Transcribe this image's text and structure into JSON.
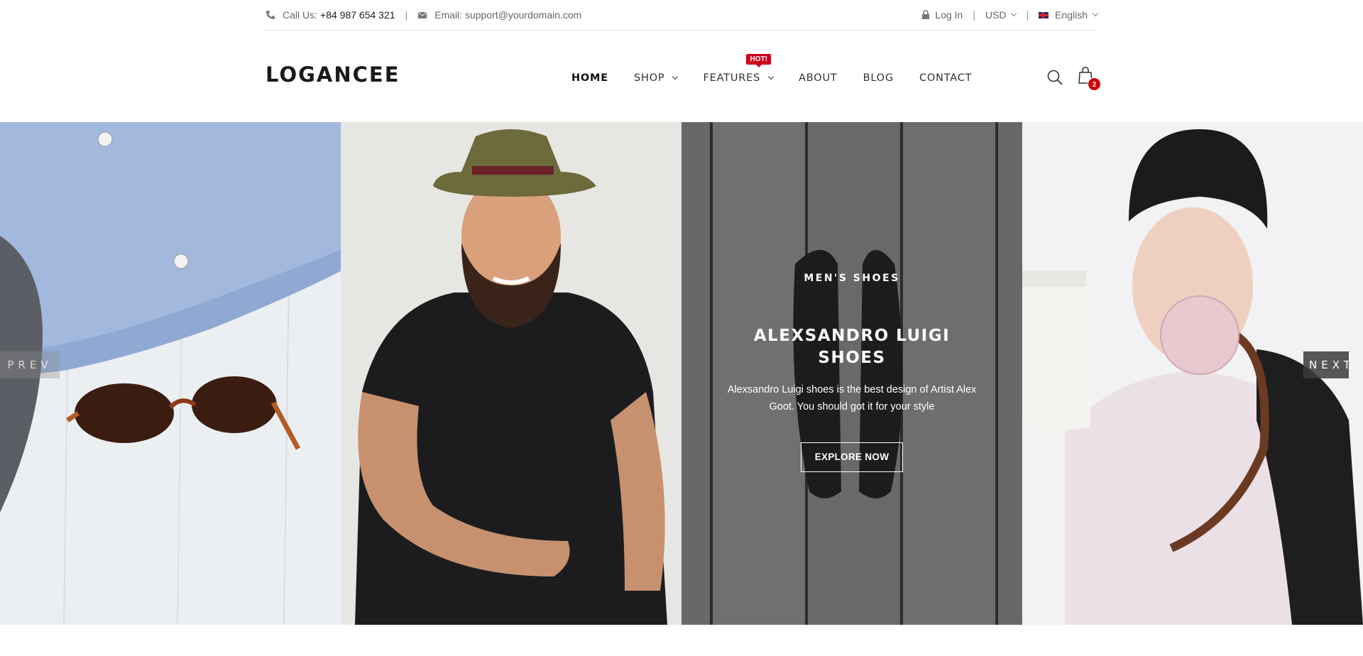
{
  "topbar": {
    "call_label": "Call Us:",
    "phone": "+84 987 654 321",
    "email": "Email: support@yourdomain.com",
    "login": "Log In",
    "currency": "USD",
    "language": "English"
  },
  "header": {
    "logo": "LOGANCEE",
    "nav": [
      {
        "label": "HOME",
        "active": true
      },
      {
        "label": "SHOP"
      },
      {
        "label": "FEATURES",
        "badge": "HOT!"
      },
      {
        "label": "ABOUT"
      },
      {
        "label": "BLOG"
      },
      {
        "label": "CONTACT"
      }
    ],
    "cart_count": "2"
  },
  "slider": {
    "prev": "PREV",
    "next": "NEXT",
    "caption": {
      "subtitle": "MEN'S SHOES",
      "title": "ALEXSANDRO LUIGI SHOES",
      "description": "Alexsandro Luigi shoes is the best design of Artist Alex Goot. You should got it for your style",
      "button": "EXPLORE NOW"
    }
  },
  "colors": {
    "accent": "#d0021b",
    "text": "#222222"
  }
}
